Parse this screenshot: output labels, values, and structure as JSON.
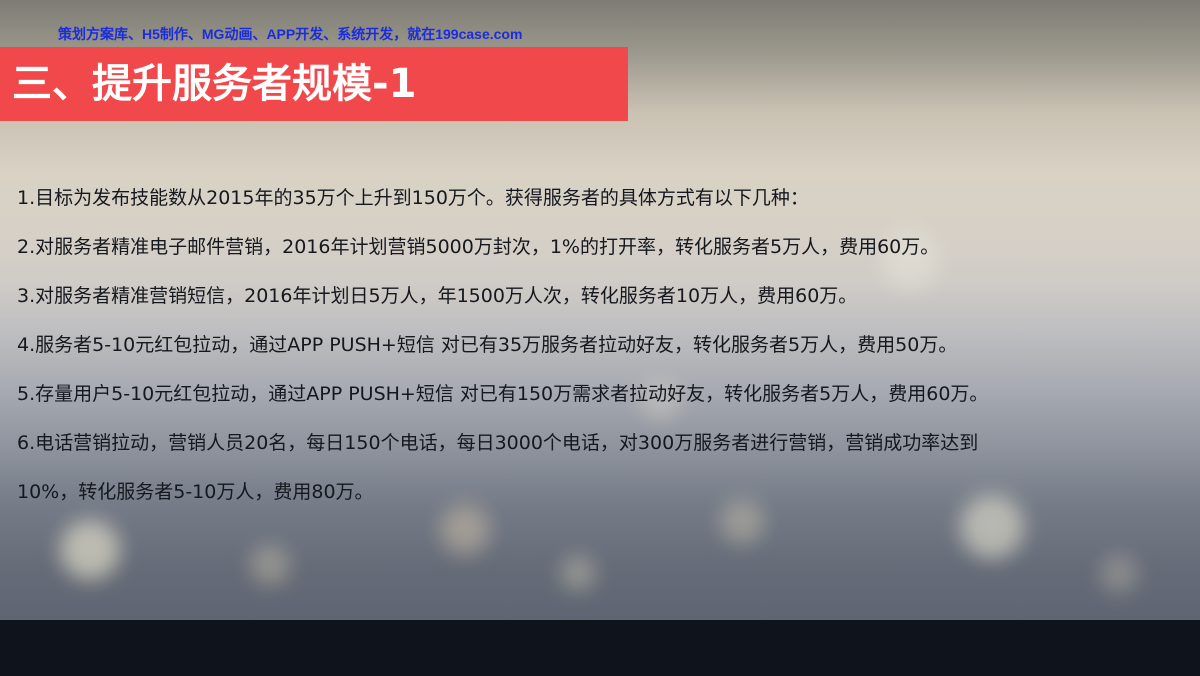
{
  "watermark": "策划方案库、H5制作、MG动画、APP开发、系统开发，就在199case.com",
  "title": "三、提升服务者规模-1",
  "lines": [
    "1.目标为发布技能数从2015年的35万个上升到150万个。获得服务者的具体方式有以下几种：",
    "2.对服务者精准电子邮件营销，2016年计划营销5000万封次，1%的打开率，转化服务者5万人，费用60万。",
    "3.对服务者精准营销短信，2016年计划日5万人，年1500万人次，转化服务者10万人，费用60万。",
    "4.服务者5-10元红包拉动，通过APP PUSH+短信 对已有35万服务者拉动好友，转化服务者5万人，费用50万。",
    "5.存量用户5-10元红包拉动，通过APP PUSH+短信 对已有150万需求者拉动好友，转化服务者5万人，费用60万。",
    "6.电话营销拉动，营销人员20名，每日150个电话，每日3000个电话，对300万服务者进行营销，营销成功率达到",
    "10%，转化服务者5-10万人，费用80万。"
  ],
  "colors": {
    "title_bar": "#f0484b",
    "watermark": "#1b2ddb",
    "body_text": "#15181e"
  }
}
